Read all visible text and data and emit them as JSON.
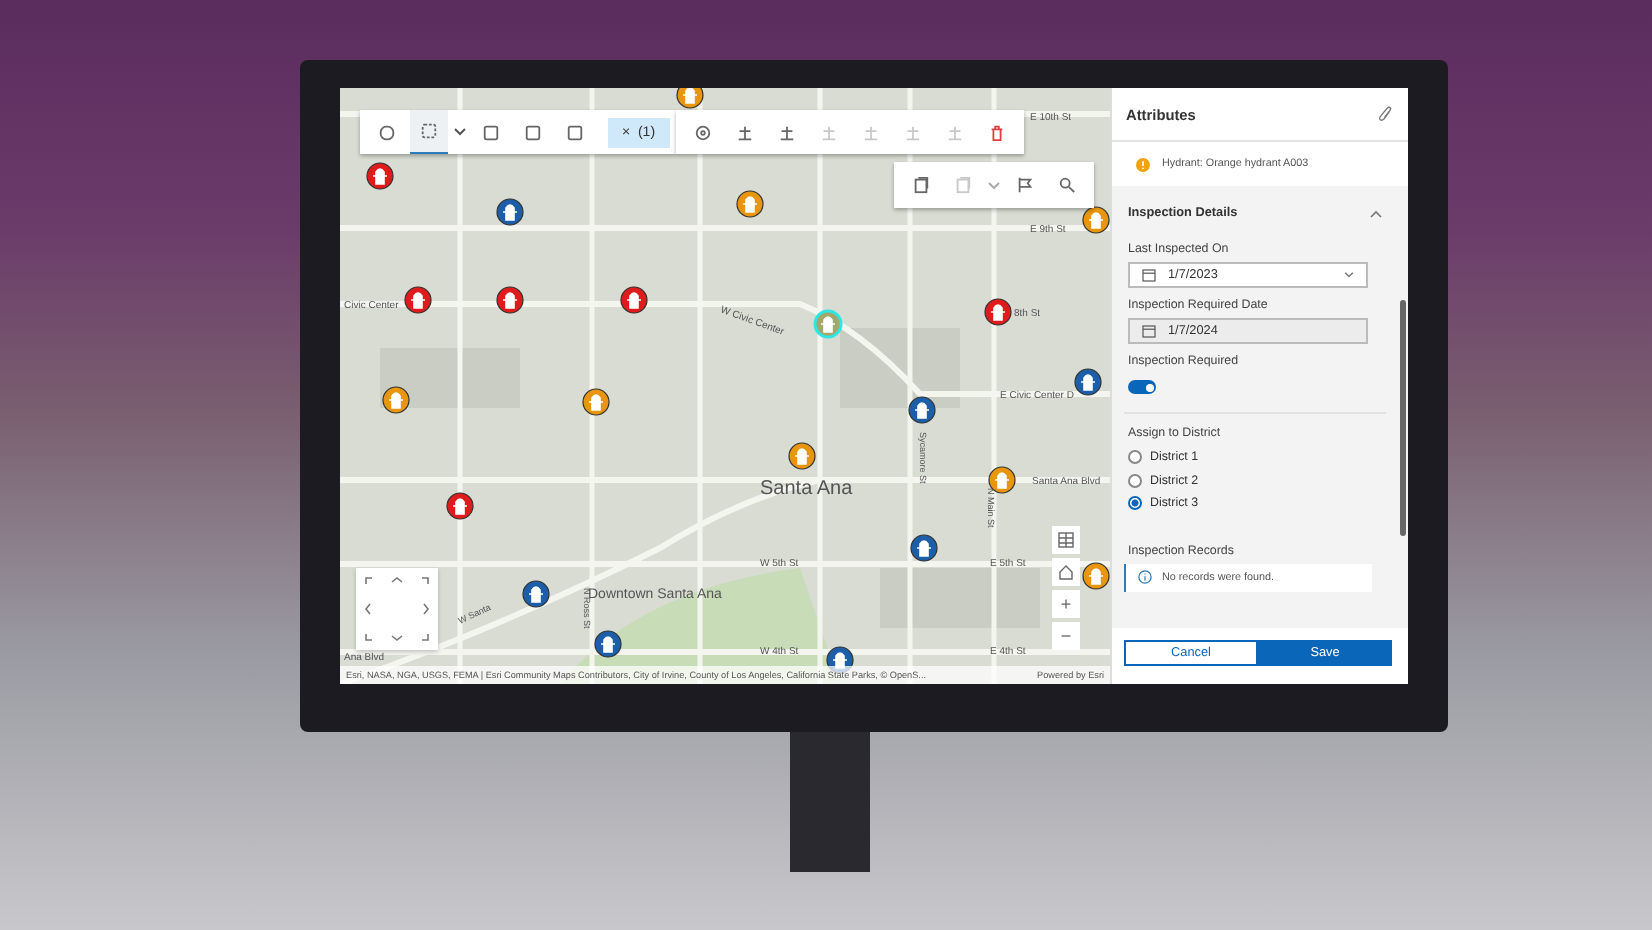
{
  "toolbars": [
    {
      "tools": [
        {
          "disabled": false,
          "selected": false
        },
        {
          "disabled": false,
          "selected": true
        },
        {
          "disabled": false,
          "selected": false
        },
        {
          "disabled": false,
          "selected": false
        },
        {
          "disabled": false,
          "selected": false
        }
      ],
      "selection_chip": {
        "close": "×",
        "count": "(1)"
      }
    },
    {
      "tools": [
        {
          "disabled": false,
          "selected": false
        },
        {
          "disabled": false,
          "selected": false
        },
        {
          "disabled": false,
          "selected": false
        },
        {
          "disabled": true,
          "selected": false
        },
        {
          "disabled": true,
          "selected": false
        },
        {
          "disabled": true,
          "selected": false
        },
        {
          "disabled": true,
          "selected": false
        },
        {
          "disabled": false,
          "selected": false
        }
      ]
    },
    {
      "tools": [
        {
          "disabled": false,
          "selected": false
        },
        {
          "disabled": true,
          "selected": false
        },
        {
          "disabled": false,
          "selected": false
        },
        {
          "disabled": false,
          "selected": false
        }
      ]
    }
  ],
  "map": {
    "labels": [
      "E 10th St",
      "E 9th St",
      "Civic Center",
      "W Civic Center",
      "8th St",
      "E Civic Center D",
      "Santa Ana",
      "Sycamore St",
      "Santa Ana Blvd",
      "N Ross St",
      "W 5th St",
      "E 5th St",
      "W Santa",
      "Downtown Santa Ana",
      "W 4th St",
      "E 4th St",
      "Ana Blvd",
      "N Main St"
    ],
    "markers": [
      {
        "color": "#e8960f",
        "selected": false
      },
      {
        "color": "#e01b1b",
        "selected": false
      },
      {
        "color": "#1d5ea8",
        "selected": false
      },
      {
        "color": "#e8960f",
        "selected": false
      },
      {
        "color": "#e8960f",
        "selected": false
      },
      {
        "color": "#e01b1b",
        "selected": false
      },
      {
        "color": "#e01b1b",
        "selected": false
      },
      {
        "color": "#e01b1b",
        "selected": false
      },
      {
        "color": "#a3a86a",
        "selected": true
      },
      {
        "color": "#e01b1b",
        "selected": false
      },
      {
        "color": "#1d5ea8",
        "selected": false
      },
      {
        "color": "#e8960f",
        "selected": false
      },
      {
        "color": "#e8960f",
        "selected": false
      },
      {
        "color": "#1d5ea8",
        "selected": false
      },
      {
        "color": "#e8960f",
        "selected": false
      },
      {
        "color": "#e8960f",
        "selected": false
      },
      {
        "color": "#e01b1b",
        "selected": false
      },
      {
        "color": "#1d5ea8",
        "selected": false
      },
      {
        "color": "#e8960f",
        "selected": false
      },
      {
        "color": "#1d5ea8",
        "selected": false
      },
      {
        "color": "#1d5ea8",
        "selected": false
      },
      {
        "color": "#1d5ea8",
        "selected": false
      }
    ],
    "zoom_in": "+",
    "zoom_out": "−",
    "attribution": "Esri, NASA, NGA, USGS, FEMA | Esri Community Maps Contributors, City of Irvine, County of Los Angeles, California State Parks, © OpenS...",
    "powered_by": "Powered by Esri"
  },
  "panel": {
    "title": "Attributes",
    "feature": "Hydrant: Orange hydrant A003",
    "section": {
      "title": "Inspection Details",
      "expanded": true
    },
    "fields": [
      {
        "kind": "date",
        "label": "Last Inspected On",
        "value": "1/7/2023",
        "disabled": false
      },
      {
        "kind": "date",
        "label": "Inspection Required Date",
        "value": "1/7/2024",
        "disabled": true
      },
      {
        "kind": "toggle",
        "label": "Inspection Required",
        "on": true
      },
      {
        "kind": "radio",
        "label": "Assign to District",
        "options": [
          {
            "label": "District 1",
            "selected": false
          },
          {
            "label": "District 2",
            "selected": false
          },
          {
            "label": "District 3",
            "selected": true
          }
        ]
      },
      {
        "kind": "notice",
        "label": "Inspection Records",
        "message": "No records were found."
      }
    ],
    "buttons": {
      "cancel": "Cancel",
      "save": "Save"
    }
  }
}
